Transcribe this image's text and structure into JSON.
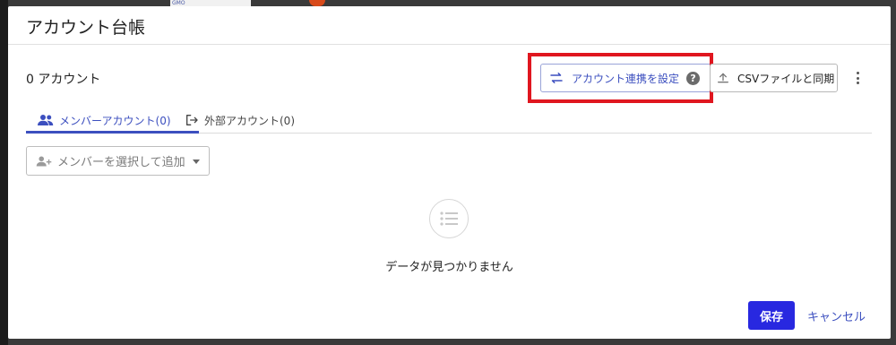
{
  "backdrop": {
    "logo_text": "GMO"
  },
  "dialog": {
    "title": "アカウント台帳",
    "account_count": "0 アカウント",
    "link_button_label": "アカウント連携を設定",
    "help_symbol": "?",
    "csv_button_label": "CSVファイルと同期",
    "tabs": [
      {
        "label": "メンバーアカウント(0)",
        "active": true
      },
      {
        "label": "外部アカウント(0)",
        "active": false
      }
    ],
    "select_placeholder": "メンバーを選択して追加",
    "empty_message": "データが見つかりません",
    "save_label": "保存",
    "cancel_label": "キャンセル"
  },
  "colors": {
    "accent": "#3c4fbf",
    "primary_button": "#2828e0",
    "highlight": "#e0161f"
  }
}
